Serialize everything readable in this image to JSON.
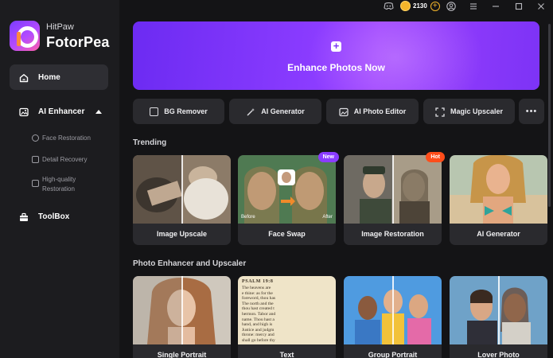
{
  "app": {
    "brand_top": "HitPaw",
    "brand_bottom": "FotorPea"
  },
  "sidebar": {
    "home": "Home",
    "ai_enhancer": "AI Enhancer",
    "sub_items": [
      {
        "label": "Face Restoration",
        "icon": "face-icon"
      },
      {
        "label": "Detail Recovery",
        "icon": "detail-icon"
      },
      {
        "label": "High-quality Restoration",
        "icon": "quality-icon"
      }
    ],
    "toolbox": "ToolBox"
  },
  "topbar": {
    "coins": "2130"
  },
  "hero": {
    "label": "Enhance Photos Now"
  },
  "tools": [
    {
      "label": "BG Remover",
      "icon": "bg-remover-icon"
    },
    {
      "label": "AI Generator",
      "icon": "magic-wand-icon"
    },
    {
      "label": "AI Photo Editor",
      "icon": "photo-editor-icon"
    },
    {
      "label": "Magic Upscaler",
      "icon": "upscale-icon"
    }
  ],
  "trending": {
    "title": "Trending",
    "cards": [
      {
        "label": "Image Upscale",
        "tag": ""
      },
      {
        "label": "Face Swap",
        "tag": "New",
        "before": "Before",
        "after": "After"
      },
      {
        "label": "Image Restoration",
        "tag": "Hot"
      },
      {
        "label": "AI Generator",
        "tag": ""
      }
    ]
  },
  "enhancer": {
    "title": "Photo Enhancer and Upscaler",
    "cards": [
      {
        "label": "Single Portrait"
      },
      {
        "label": "Text"
      },
      {
        "label": "Group Portrait"
      },
      {
        "label": "Lover Photo"
      }
    ],
    "text_card": {
      "heading": "PSALM 19:8",
      "lines": [
        "The heavens are",
        "e thine: as for the",
        "foreword, thou has",
        "The north and the",
        "thou hast created t",
        "hermon. Tabor and",
        "name. Thou hast a",
        "hand, and high is",
        "Justice and judgm",
        "throne: mercy and",
        "shall go before thy"
      ]
    }
  },
  "colors": {
    "accent": "#8b3cff",
    "new_tag": "#8a3cff",
    "hot_tag": "#ff4d1a",
    "coin": "#f4b52b"
  }
}
